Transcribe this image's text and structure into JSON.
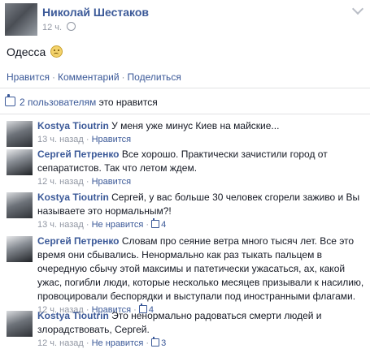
{
  "post": {
    "author": "Николай Шестаков",
    "time": "12 ч.",
    "text": "Одесса",
    "actions": [
      "Нравится",
      "Комментарий",
      "Поделиться"
    ]
  },
  "likes": {
    "link": "2 пользователям",
    "suffix": "это нравится"
  },
  "comments": [
    {
      "author": "Kostya Tioutrin",
      "text": "У меня уже минус Киев на майские...",
      "time": "13 ч. назад",
      "action": "Нравится",
      "likes": ""
    },
    {
      "author": "Сергей Петренко",
      "text": "Все хорошо. Практически зачистили город от сепаратистов. Так что летом ждем.",
      "time": "12 ч. назад",
      "action": "Нравится",
      "likes": ""
    },
    {
      "author": "Kostya Tioutrin",
      "text": "Сергей, у вас больше 30 человек сгорели заживо и Вы называете это нормальным?!",
      "time": "13 ч. назад",
      "action": "Не нравится",
      "likes": "4"
    },
    {
      "author": "Сергей Петренко",
      "text": "Словам про сеяние ветра много тысяч лет. Все это время они сбывались. Ненормально как раз тыкать пальцем в очередную сбычу этой максимы и патетически ужасаться, ах, какой ужас, погибли люди, которые несколько месяцев призывали к насилию, провоцировали беспорядки и выступали под иностранными флагами.",
      "time": "12 ч. назад",
      "action": "Нравится",
      "likes": "4"
    },
    {
      "author": "Kostya Tioutrin",
      "text": "Это ненормально радоваться смерти людей и злорадствовать, Сергей.",
      "time": "12 ч. назад",
      "action": "Не нравится",
      "likes": "3"
    }
  ]
}
